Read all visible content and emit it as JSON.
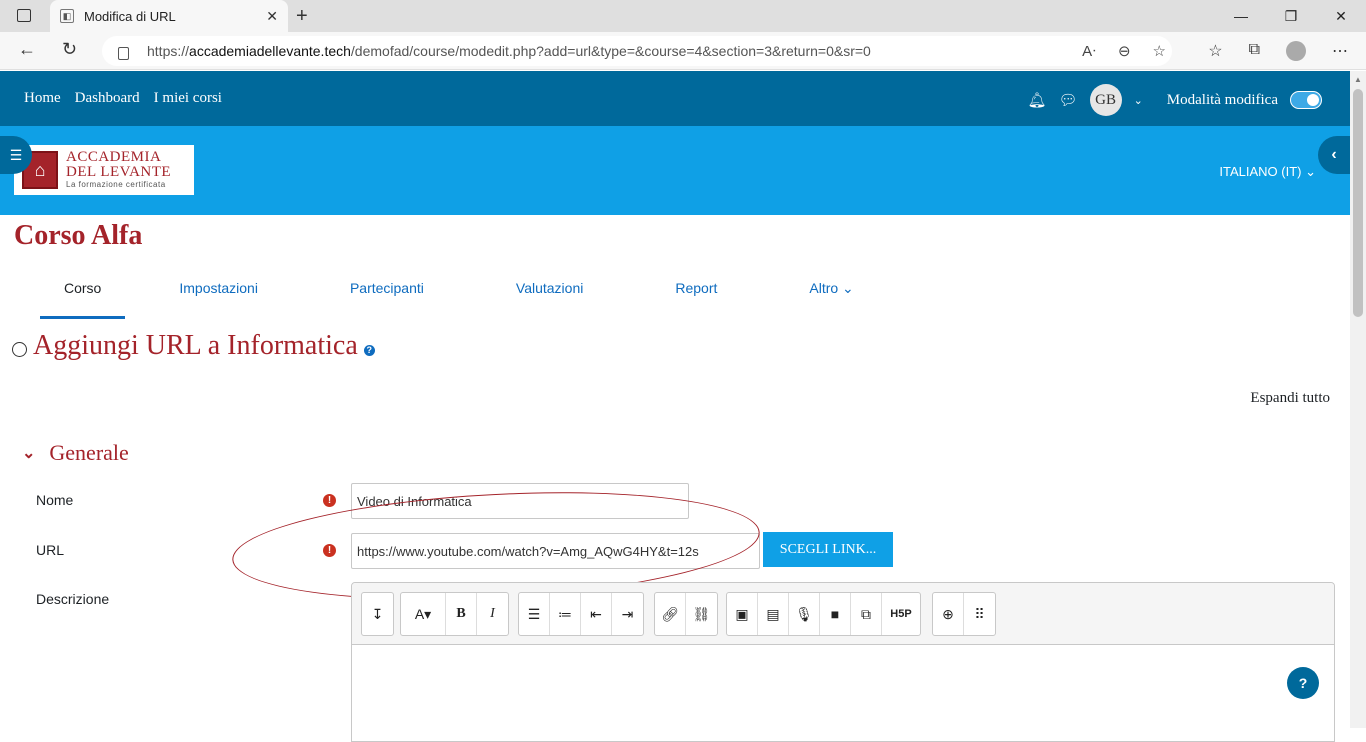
{
  "browser": {
    "tab_title": "Modifica di URL",
    "tab_close": "✕",
    "new_tab": "+",
    "url_prefix": "https://",
    "url_host": "accademiadellevante.tech",
    "url_path": "/demofad/course/modedit.php?add=url&type=&course=4&section=3&return=0&sr=0"
  },
  "topnav": {
    "links": [
      "Home",
      "Dashboard",
      "I miei corsi"
    ],
    "user_initials": "GB",
    "edit_mode_label": "Modalità modifica"
  },
  "banner": {
    "logo_line1": "ACCADEMIA",
    "logo_line2": "DEL LEVANTE",
    "logo_tagline": "La formazione certificata",
    "language": "ITALIANO (IT) ⌄"
  },
  "course": {
    "title": "Corso Alfa",
    "tabs": [
      "Corso",
      "Impostazioni",
      "Partecipanti",
      "Valutazioni",
      "Report",
      "Altro ⌄"
    ]
  },
  "page": {
    "heading": "Aggiungi URL a Informatica",
    "expand_all": "Espandi tutto",
    "section_title": "Generale"
  },
  "form": {
    "name_label": "Nome",
    "name_value": "Video di Informatica",
    "url_label": "URL",
    "url_value": "https://www.youtube.com/watch?v=Amg_AQwG4HY&t=12s",
    "choose_link": "SCEGLI LINK...",
    "description_label": "Descrizione"
  },
  "colors": {
    "nav_blue": "#00699b",
    "banner_blue": "#0fa0e6",
    "brand_red": "#a4232a"
  }
}
